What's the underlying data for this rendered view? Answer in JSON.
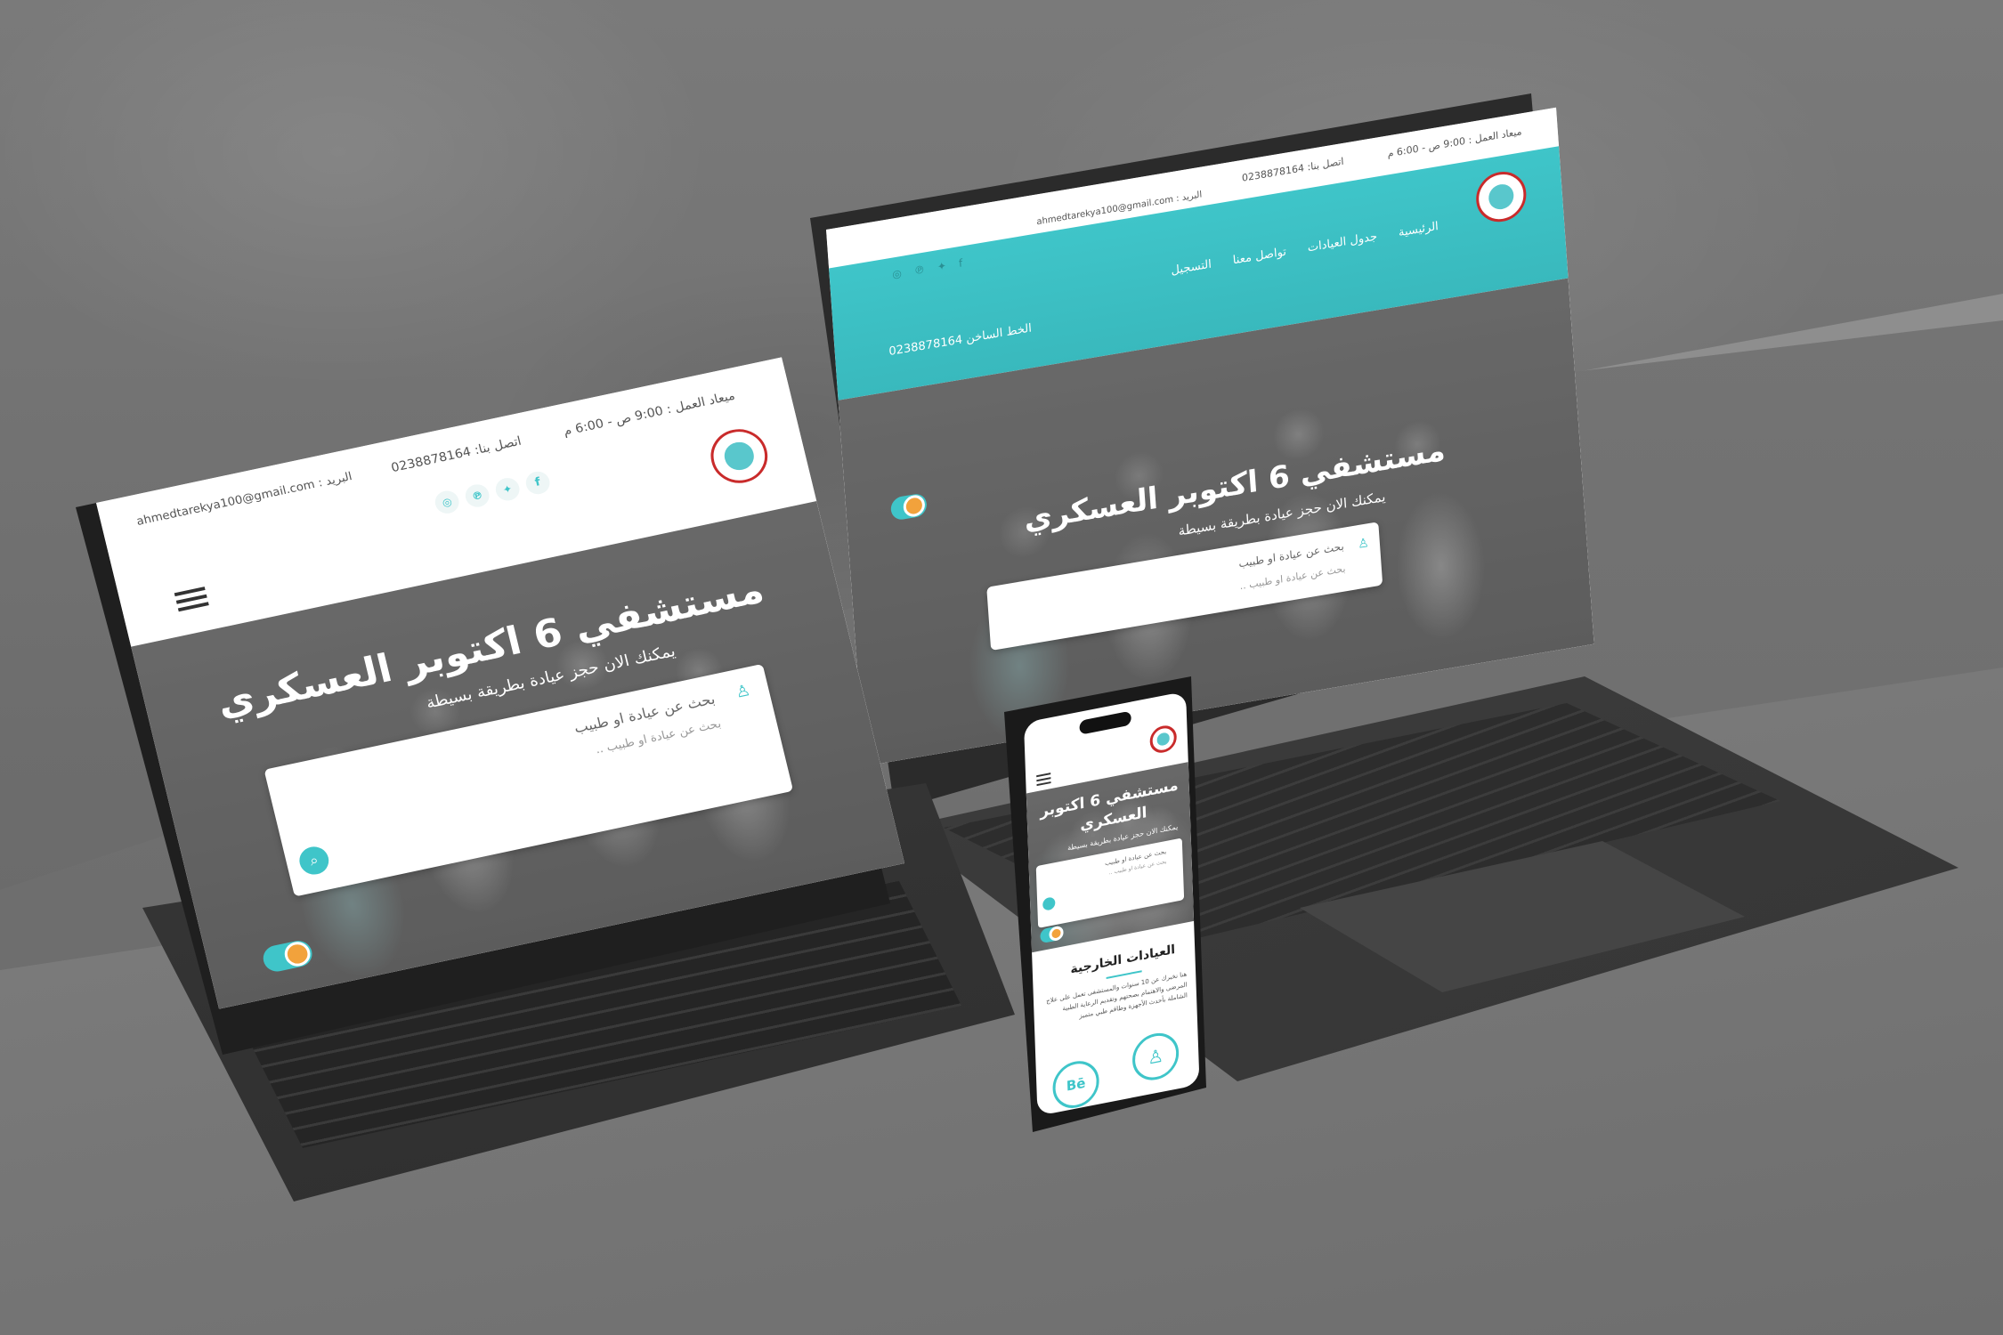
{
  "site": {
    "title": "مستشفي 6 اكتوبر العسكري",
    "title_line1": "مستشفي 6 اكتوبر",
    "title_line2": "العسكري",
    "subtitle": "يمكنك الان حجز عيادة بطريقة بسيطة",
    "search_label": "بحث عن عيادة او طبيب",
    "search_placeholder": "بحث عن عيادة او طبيب ..",
    "working_hours": "ميعاد العمل : 9:00 ص - 6:00 م",
    "phone": "اتصل بنا: 0238878164",
    "email": "البريد : ahmedtarekya100@gmail.com",
    "email_short": "ahmedtarekya100@gmail.com",
    "hotline": "الخط الساخن 0238878164",
    "nav": [
      "الرئيسية",
      "جدول العيادات",
      "تواصل معنا",
      "التسجيل"
    ],
    "section_title": "العيادات الخارجية",
    "section_body": "هنا نخبرك عن 10 سنوات والمستشفى تعمل على علاج المرضى والاهتمام بصحتهم وتقديم الرعاية الطبية الشاملة بأحدث الأجهزة وطاقم طبي متميز"
  },
  "colors": {
    "accent": "#3fc5c9",
    "logo_red": "#c92b2b",
    "toggle_knob": "#f2a23c"
  },
  "icons": [
    "clock-icon",
    "phone-icon",
    "mail-icon",
    "facebook-icon",
    "twitter-icon",
    "pinterest-icon",
    "instagram-icon",
    "search-icon",
    "user-icon",
    "menu-icon"
  ]
}
